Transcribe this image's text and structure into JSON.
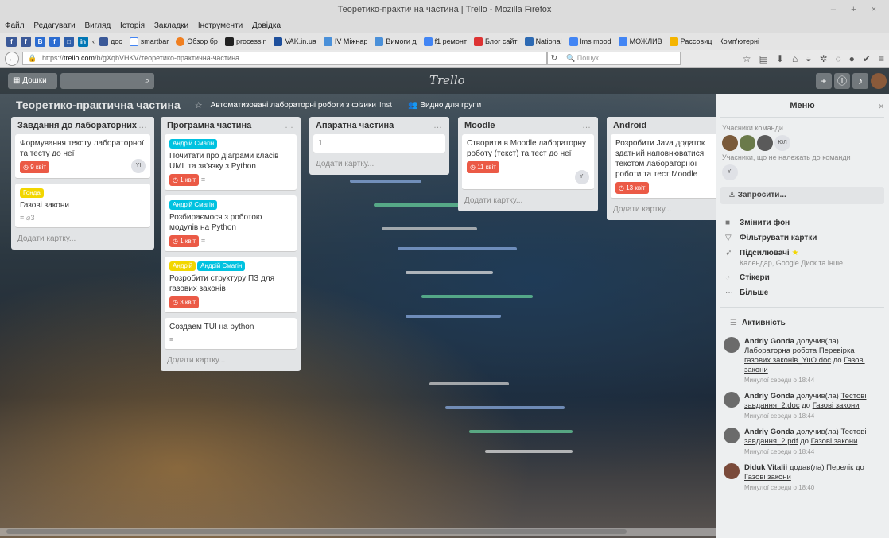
{
  "window": {
    "title": "Теоретико-практична частина | Trello - Mozilla Firefox",
    "controls": "– + ×"
  },
  "menubar": [
    "Файл",
    "Редагувати",
    "Вигляд",
    "Історія",
    "Закладки",
    "Інструменти",
    "Довідка"
  ],
  "bookmarks": [
    {
      "label": "дос",
      "color": "#3b5998"
    },
    {
      "label": "smartbar",
      "color": "#e9e9e9"
    },
    {
      "label": "Обзор бр",
      "color": "#f07f20"
    },
    {
      "label": "processin",
      "color": "#222222"
    },
    {
      "label": "VAK.in.ua",
      "color": "#1e4f9c"
    },
    {
      "label": "IV Міжнар",
      "color": "#4a90d9"
    },
    {
      "label": "Вимоги д",
      "color": "#4a90d9"
    },
    {
      "label": "f1 ремонт",
      "color": "#4285f4"
    },
    {
      "label": "Блог сайт",
      "color": "#d33"
    },
    {
      "label": "National",
      "color": "#2d6ab3"
    },
    {
      "label": "lms mood",
      "color": "#4285f4"
    },
    {
      "label": "МОЖЛИВ",
      "color": "#4285f4"
    },
    {
      "label": "Рассовиц",
      "color": "#f4b400"
    },
    {
      "label": "Комп'ютерні",
      "color": "#bbb"
    }
  ],
  "urlbar": {
    "prefix": "https://",
    "host": "trello.com",
    "path": "/b/gXqbVHKV/теоретико-практична-частина",
    "search_placeholder": "Пошук"
  },
  "header": {
    "boards_label": "Дошки",
    "logo": "Trello"
  },
  "board": {
    "title": "Теоретико-практична частина",
    "team": "Автоматизовані лабораторні роботи з фізики",
    "team_tag": "Inst",
    "visibility": "Видно для групи"
  },
  "lists": [
    {
      "title": "Завдання до лабораторних",
      "add": "Додати картку...",
      "cards": [
        {
          "text": "Формування тексту лабораторної та тесту до неї",
          "due": "9 квіт",
          "avatar": "YI"
        },
        {
          "label": "Гонда",
          "label_color": "#f2d600",
          "text": "Газові закони",
          "attach": "3"
        }
      ]
    },
    {
      "title": "Програмна частина",
      "add": "Додати картку...",
      "cards": [
        {
          "label": "Андрій Смагін",
          "label_color": "#00c2e0",
          "text": "Почитати про діаграми класів UML та зв'язку з Python",
          "due": "1 квіт"
        },
        {
          "label": "Андрій Смагін",
          "label_color": "#00c2e0",
          "text": "Розбираємося з роботою модулів на Python",
          "due": "1 квіт"
        },
        {
          "label": "Андрій",
          "label_color": "#f2d600",
          "label2": "Андрій Смагін",
          "label2_color": "#00c2e0",
          "text": "Розробити структуру ПЗ для газових законів",
          "due": "3 квіт"
        },
        {
          "text": "Создаем TUI на python"
        }
      ]
    },
    {
      "title": "Апаратна частина",
      "add": "Додати картку...",
      "cards": [
        {
          "text": "1"
        }
      ]
    },
    {
      "title": "Moodle",
      "add": "Додати картку...",
      "cards": [
        {
          "text": "Створити в Moodle лабораторну роботу (текст) та тест до неї",
          "due": "11 квіт",
          "avatar": "YI"
        }
      ]
    },
    {
      "title": "Android",
      "add": "Додати картку...",
      "cards": [
        {
          "text": "Розробити Java додаток здатний наповнюватися текстом лабораторної роботи та тест Moodle",
          "due": "13 квіт"
        }
      ]
    }
  ],
  "menu": {
    "title": "Меню",
    "members_label": "Учасники команди",
    "members_more": "ЮЛ",
    "nonmembers_label": "Учасники, що не належать до команди",
    "nonmember_avatar": "YI",
    "invite": "Запросити...",
    "items": [
      {
        "label": "Змінити фон",
        "icon": "square-icon"
      },
      {
        "label": "Фільтрувати картки",
        "icon": "filter-icon"
      },
      {
        "label": "Підсилювачі",
        "sub": "Календар, Google Диск та інше...",
        "icon": "rocket-icon"
      },
      {
        "label": "Стікери",
        "icon": "sticker-icon"
      },
      {
        "label": "Більше",
        "icon": "more-icon"
      }
    ],
    "activity_title": "Активність",
    "activities": [
      {
        "user": "Andriy Gonda",
        "verb": "долучив(ла)",
        "obj": "Лабораторна робота Перевірка газових законів_YuO.doc",
        "prep": "до",
        "target": "Газові закони",
        "time": "Минулої середи о 18:44"
      },
      {
        "user": "Andriy Gonda",
        "verb": "долучив(ла)",
        "obj": "Тестові завдання_2.doc",
        "prep": "до",
        "target": "Газові закони",
        "time": "Минулої середи о 18:44"
      },
      {
        "user": "Andriy Gonda",
        "verb": "долучив(ла)",
        "obj": "Тестові завдання_2.pdf",
        "prep": "до",
        "target": "Газові закони",
        "time": "Минулої середи о 18:44"
      },
      {
        "user": "Diduk Vitalii",
        "verb": "додав(ла)",
        "obj": "Перелік до",
        "prep": "",
        "target": "Газові закони",
        "time": "Минулої середи о 18:40"
      }
    ]
  }
}
